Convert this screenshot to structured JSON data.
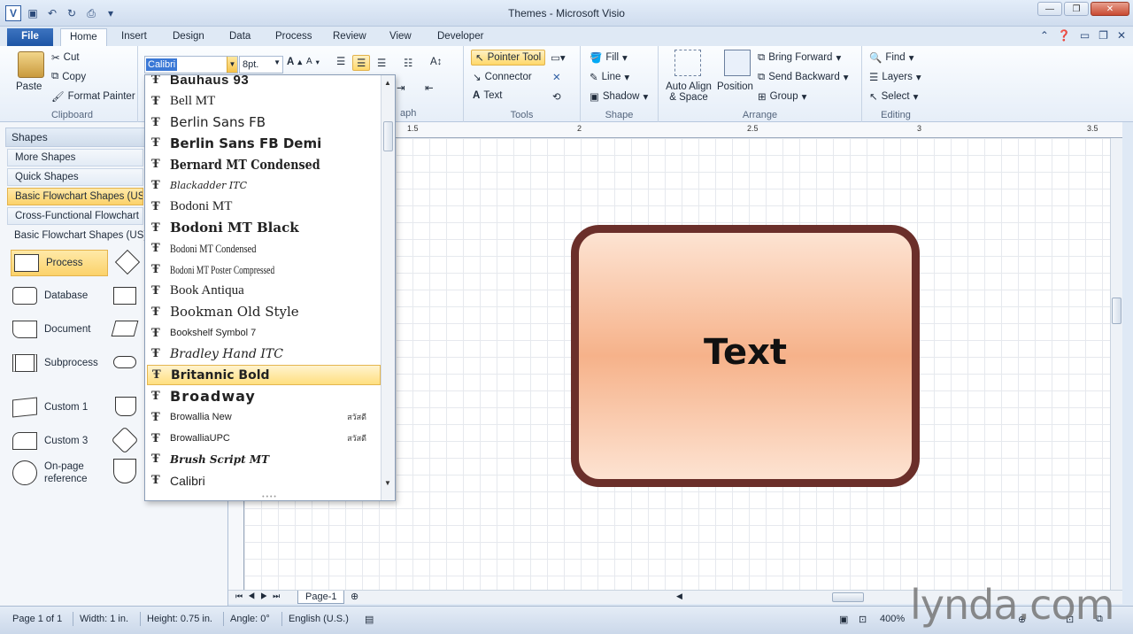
{
  "window": {
    "title": "Themes - Microsoft Visio"
  },
  "tabs": [
    "File",
    "Home",
    "Insert",
    "Design",
    "Data",
    "Process",
    "Review",
    "View",
    "Developer"
  ],
  "active_tab": "Home",
  "ribbon": {
    "clipboard": {
      "paste": "Paste",
      "cut": "Cut",
      "copy": "Copy",
      "format_painter": "Format Painter",
      "label": "Clipboard"
    },
    "font": {
      "name": "Calibri",
      "size": "8pt."
    },
    "paragraph": {
      "label": "aph"
    },
    "tools": {
      "pointer": "Pointer Tool",
      "connector": "Connector",
      "text": "Text",
      "label": "Tools"
    },
    "shape": {
      "fill": "Fill",
      "line": "Line",
      "shadow": "Shadow",
      "label": "Shape"
    },
    "arrange": {
      "auto_align": "Auto Align & Space",
      "position": "Position",
      "bring_forward": "Bring Forward",
      "send_backward": "Send Backward",
      "group": "Group",
      "label": "Arrange"
    },
    "editing": {
      "find": "Find",
      "layers": "Layers",
      "select": "Select",
      "label": "Editing"
    }
  },
  "shapes_pane": {
    "header": "Shapes",
    "stencils": [
      "More Shapes",
      "Quick Shapes",
      "Basic Flowchart Shapes (US",
      "Cross-Functional Flowchart"
    ],
    "stencil_title": "Basic Flowchart Shapes (US)",
    "items": [
      "Process",
      "Database",
      "Document",
      "Subprocess",
      "Custom 1",
      "Custom 3",
      "On-page reference"
    ]
  },
  "font_list": [
    {
      "name": "Bauhaus 93"
    },
    {
      "name": "Bell MT"
    },
    {
      "name": "Berlin Sans FB"
    },
    {
      "name": "Berlin Sans FB Demi"
    },
    {
      "name": "Bernard MT Condensed"
    },
    {
      "name": "Blackadder ITC"
    },
    {
      "name": "Bodoni MT"
    },
    {
      "name": "Bodoni MT Black"
    },
    {
      "name": "Bodoni MT Condensed"
    },
    {
      "name": "Bodoni MT Poster Compressed"
    },
    {
      "name": "Book Antiqua"
    },
    {
      "name": "Bookman Old Style"
    },
    {
      "name": "Bookshelf Symbol 7"
    },
    {
      "name": "Bradley Hand ITC"
    },
    {
      "name": "Britannic Bold"
    },
    {
      "name": "Broadway"
    },
    {
      "name": "Browallia New",
      "sample": "สวัสดี"
    },
    {
      "name": "BrowalliaUPC",
      "sample": "สวัสดี"
    },
    {
      "name": "Brush Script MT"
    },
    {
      "name": "Calibri"
    }
  ],
  "highlighted_font": "Britannic Bold",
  "canvas": {
    "ruler_labels": [
      "1.5",
      "2",
      "2.5",
      "3",
      "3.5"
    ],
    "shape_text": "Text",
    "page_tab": "Page-1"
  },
  "status": {
    "page": "Page 1 of 1",
    "width": "Width: 1 in.",
    "height": "Height: 0.75 in.",
    "angle": "Angle: 0°",
    "language": "English (U.S.)",
    "zoom": "400%"
  },
  "watermark": "lynda.com"
}
